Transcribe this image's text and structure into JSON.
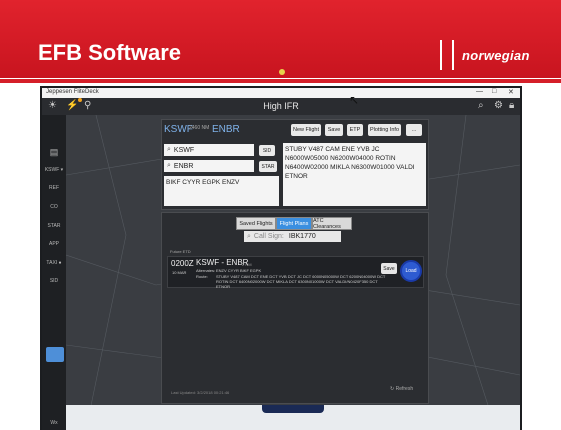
{
  "slide": {
    "title": "EFB Software",
    "brand": "norwegian"
  },
  "status_bar": {
    "app_name": "Jeppesen FliteDeck",
    "window_controls": [
      "—",
      "□",
      "✕"
    ]
  },
  "app_bar": {
    "title": "High IFR",
    "left_icons": [
      "brightness-icon",
      "weather-icon",
      "location-pin-icon"
    ],
    "right_icons": [
      "search-icon",
      "settings-icon",
      "lock-icon"
    ]
  },
  "sidebar": {
    "items": [
      {
        "label": "KSWF ▾"
      },
      {
        "label": "REF"
      },
      {
        "label": "CO"
      },
      {
        "label": "STAR"
      },
      {
        "label": "APP"
      },
      {
        "label": "TAXI ●"
      },
      {
        "label": "SID"
      },
      {
        "label": "Wx"
      }
    ]
  },
  "route_panel": {
    "from": "KSWF",
    "arrow_label": "2460 NM",
    "to": "ENBR",
    "buttons": [
      "New Flight",
      "Save",
      "ETP",
      "Plotting Info",
      "..."
    ],
    "departure": {
      "value": "KSWF",
      "button": "SID"
    },
    "arrival": {
      "value": "ENBR",
      "button": "STAR"
    },
    "alternates": "BIKF CYYR EGPK ENZV",
    "route_text": "STUBY V487 CAM ENE YVB JC N6000W05000 N6200W04000 ROTIN N6400W02000 MIKLA N6300W01000 VALDI ETNOR"
  },
  "plans_panel": {
    "tabs": [
      {
        "label": "Saved Flights",
        "selected": false
      },
      {
        "label": "Flight Plans",
        "selected": true
      },
      {
        "label": "ATC Clearances",
        "selected": false
      }
    ],
    "callsign_placeholder": "Call Sign:",
    "callsign_value": "IBK1770",
    "section_label": "Future ETD",
    "flight_plan": {
      "time": "0200Z",
      "ago": "10 MAR",
      "route": "KSWF - ENBR",
      "heading": "2 NM",
      "alternates_label": "Alternates:",
      "alternates": "ENZV CYYR BIKF EGPK",
      "route_label": "Route:",
      "route_line1": "STUBY V487 CAM DCT ENE DCT YVB DCT JC DCT 6000N05000W DCT 6200N04000W DCT",
      "route_line2": "ROTIN DCT 6400N02000W DCT MIKLA DCT 6300N01000W DCT VALDI/N0420F350 DCT",
      "route_line3": "ETNOR",
      "save_label": "Save",
      "load_label": "Load"
    },
    "last_updated": "Last Updated: 3/2/2018 00:21:46",
    "refresh_label": "Refresh"
  }
}
